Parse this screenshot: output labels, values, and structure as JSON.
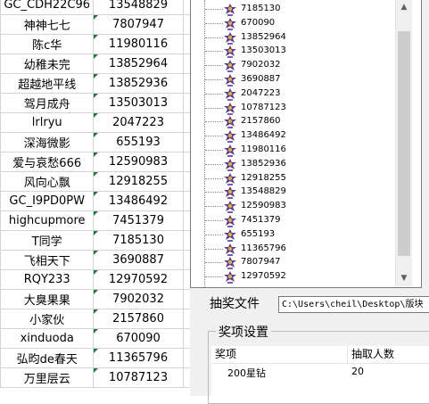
{
  "sheet": {
    "rows": [
      {
        "name": "GC_CDH22C96",
        "value": "13548829"
      },
      {
        "name": "神神七七",
        "value": "7807947"
      },
      {
        "name": "陈c华",
        "value": "11980116"
      },
      {
        "name": "幼稚未完",
        "value": "13852964"
      },
      {
        "name": "超越地平线",
        "value": "13852936"
      },
      {
        "name": "驾月成舟",
        "value": "13503013"
      },
      {
        "name": "lrlryu",
        "value": "2047223"
      },
      {
        "name": "深海微影",
        "value": "655193"
      },
      {
        "name": "爱与哀愁666",
        "value": "12590983"
      },
      {
        "name": "风向心飘",
        "value": "12918255"
      },
      {
        "name": "GC_I9PD0PW",
        "value": "13486492"
      },
      {
        "name": "highcupmore",
        "value": "7451379"
      },
      {
        "name": "T同学",
        "value": "7185130"
      },
      {
        "name": "飞相天下",
        "value": "3690887"
      },
      {
        "name": "RQY233",
        "value": "12970592"
      },
      {
        "name": "大臭果果",
        "value": "7902032"
      },
      {
        "name": "小家伙",
        "value": "2157860"
      },
      {
        "name": "xinduoda",
        "value": "670090"
      },
      {
        "name": "弘昀de春天",
        "value": "11365796"
      },
      {
        "name": "万里层云",
        "value": "10787123"
      }
    ]
  },
  "tree": {
    "icon": "user-icon",
    "items": [
      "7185130",
      "670090",
      "13852964",
      "13503013",
      "7902032",
      "3690887",
      "2047223",
      "10787123",
      "2157860",
      "13486492",
      "11980116",
      "13852936",
      "12918255",
      "13548829",
      "12590983",
      "7451379",
      "655193",
      "11365796",
      "7807947",
      "12970592"
    ],
    "scroll_up_icon": "scroll-up-icon",
    "scroll_down_icon": "scroll-down-icon"
  },
  "file": {
    "label": "抽奖文件",
    "path": "C:\\Users\\cheil\\Desktop\\版块"
  },
  "prizes": {
    "group_title": "奖项设置",
    "columns": [
      "奖项",
      "抽取人数"
    ],
    "rows": [
      {
        "item": "200星钻",
        "count": "20"
      }
    ]
  },
  "colors": {
    "cell_marker": "#1f7a3a",
    "grid_border": "#d4d4d4",
    "panel_bg": "#f0f0f0"
  }
}
